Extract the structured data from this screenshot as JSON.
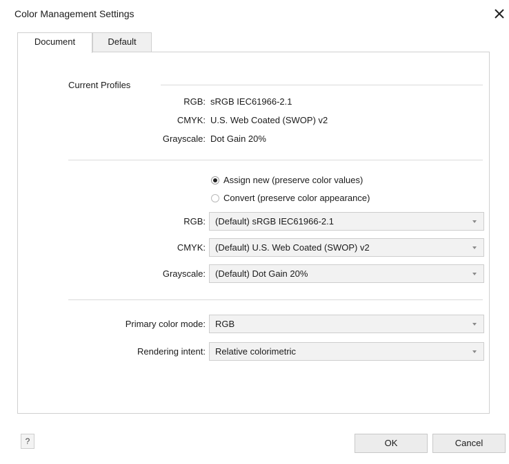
{
  "window": {
    "title": "Color Management Settings",
    "close_icon": "close-icon"
  },
  "tabs": [
    {
      "label": "Document",
      "selected": true
    },
    {
      "label": "Default",
      "selected": false
    }
  ],
  "current_profiles": {
    "heading": "Current Profiles",
    "rows": [
      {
        "label": "RGB:",
        "value": "sRGB IEC61966-2.1"
      },
      {
        "label": "CMYK:",
        "value": "U.S. Web Coated (SWOP) v2"
      },
      {
        "label": "Grayscale:",
        "value": "Dot Gain 20%"
      }
    ]
  },
  "options": {
    "assign_label": "Assign new (preserve color values)",
    "assign_checked": true,
    "convert_label": "Convert (preserve color appearance)",
    "convert_checked": false
  },
  "profile_selects": [
    {
      "label": "RGB:",
      "value": "(Default) sRGB IEC61966-2.1"
    },
    {
      "label": "CMYK:",
      "value": "(Default) U.S. Web Coated (SWOP) v2"
    },
    {
      "label": "Grayscale:",
      "value": "(Default) Dot Gain 20%"
    }
  ],
  "primary_color_mode": {
    "label": "Primary color mode:",
    "value": "RGB"
  },
  "rendering_intent": {
    "label": "Rendering intent:",
    "value": "Relative colorimetric"
  },
  "footer": {
    "help_label": "?",
    "ok_label": "OK",
    "cancel_label": "Cancel"
  }
}
